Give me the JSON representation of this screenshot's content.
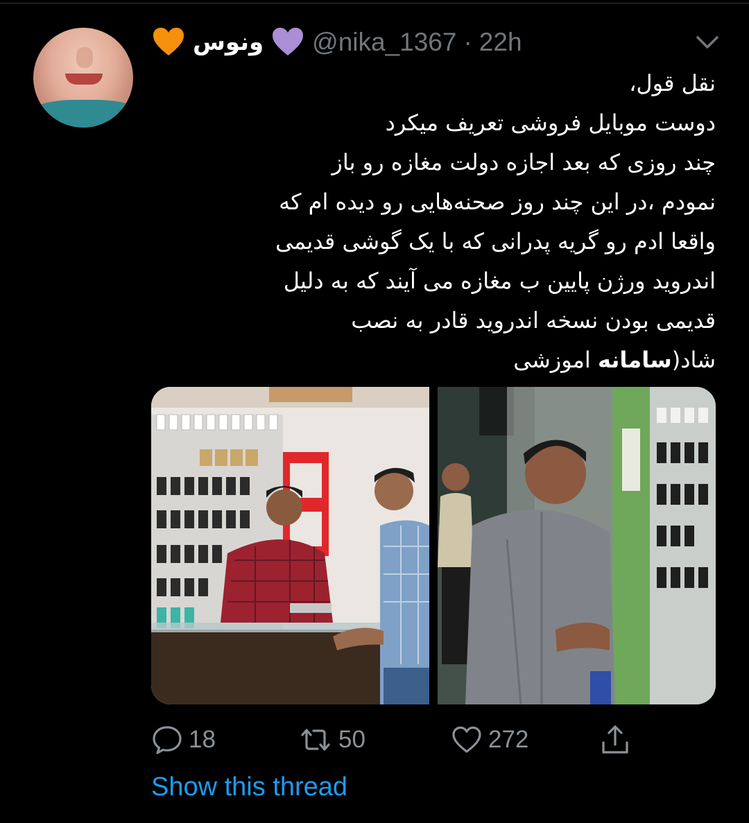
{
  "tweet": {
    "display_name": "ونوس",
    "handle": "@nika_1367",
    "separator": "·",
    "time": "22h",
    "lines": [
      "نقل قول،",
      "دوست  موبایل فروشی  تعریف میکرد",
      "چند روزی که بعد اجازه دولت مغازه رو باز",
      "نمودم ،در این چند روز صحنه‌هایی رو دیده ام که",
      "واقعا ادم رو گریه پدرانی  که با یک گوشی قدیمی",
      "اندروید ورژن پایین ب مغازه می آیند که به دلیل",
      "قدیمی بودن نسخه اندروید قادر به نصب"
    ],
    "last_line_prefix": "شاد(",
    "last_line_bold": "سامانه",
    "last_line_suffix": " اموزشی",
    "replies": "18",
    "retweets": "50",
    "likes": "272",
    "show_thread": "Show this thread"
  },
  "icons": {
    "name_left_emoji": "orange-heart",
    "name_right_emoji": "purple-heart",
    "reply": "comment-icon",
    "retweet": "retweet-icon",
    "like": "heart-icon",
    "share": "share-icon",
    "menu": "chevron-down-icon"
  },
  "colors": {
    "background": "#000000",
    "text": "#ffffff",
    "secondary": "#71767b",
    "link": "#1d9bf0",
    "orange_heart": "#f4900c",
    "purple_heart": "#aa8ed6"
  }
}
